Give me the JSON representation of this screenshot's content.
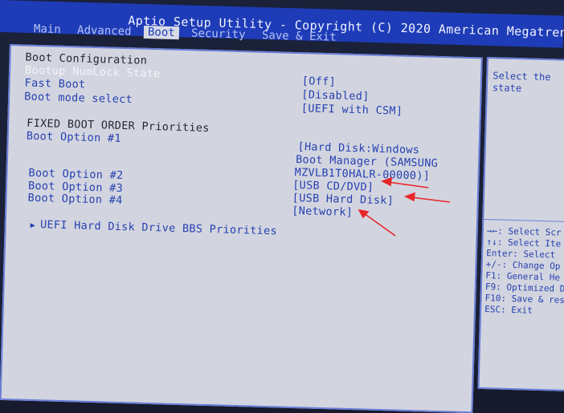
{
  "title": "Aptio Setup Utility - Copyright (C) 2020 American Megatrends",
  "tabs": [
    {
      "label": "Main"
    },
    {
      "label": "Advanced"
    },
    {
      "label": "Boot"
    },
    {
      "label": "Security"
    },
    {
      "label": "Save & Exit"
    }
  ],
  "boot": {
    "section_title": "Boot Configuration",
    "numlock": {
      "label": "Bootup NumLock State",
      "value": "[Off]"
    },
    "fast_boot": {
      "label": "Fast Boot",
      "value": "[Disabled]"
    },
    "boot_mode": {
      "label": "Boot mode select",
      "value": "[UEFI with CSM]"
    },
    "priorities_title": "FIXED BOOT ORDER Priorities",
    "options": [
      {
        "label": "Boot Option #1",
        "value_lines": [
          "[Hard Disk:Windows",
          "Boot Manager (SAMSUNG",
          "MZVLB1T0HALR-00000)]"
        ]
      },
      {
        "label": "Boot Option #2",
        "value": "[USB CD/DVD]"
      },
      {
        "label": "Boot Option #3",
        "value": "[USB Hard Disk]"
      },
      {
        "label": "Boot Option #4",
        "value": "[Network]"
      }
    ],
    "submenu": "UEFI Hard Disk Drive BBS Priorities"
  },
  "help": {
    "description_lines": [
      "Select the",
      "state"
    ],
    "keys": [
      "→←: Select Scr",
      "↑↓: Select Ite",
      "Enter: Select",
      "+/-: Change Op",
      "F1: General He",
      "F9: Optimized D",
      "F10: Save & res",
      "ESC: Exit"
    ]
  },
  "colors": {
    "title_bar": "#1e3cb8",
    "panel": "#d2d5df",
    "value_text": "#2740b2",
    "annotation_arrow": "#e8262a"
  }
}
